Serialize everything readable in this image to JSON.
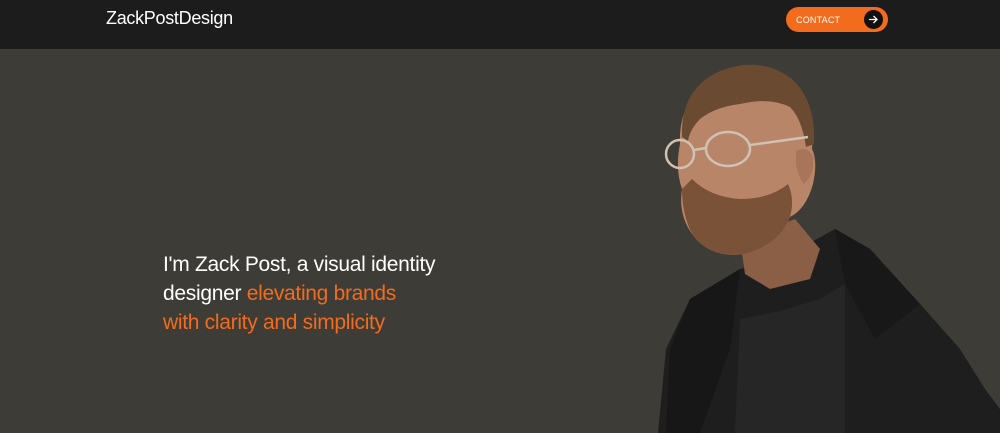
{
  "nav": {
    "logo": "ZackPostDesign",
    "contact_label": "CONTACT"
  },
  "hero": {
    "headline_line1": "I'm Zack Post, a visual identity",
    "headline_white2": "designer ",
    "headline_accent2": "elevating brands",
    "headline_accent3": "with clarity and simplicity"
  },
  "colors": {
    "accent": "#f36b1c",
    "nav_bg": "#1c1c1c",
    "hero_bg": "#3d3c37"
  },
  "icons": {
    "contact_arrow": "arrow-right-icon"
  }
}
